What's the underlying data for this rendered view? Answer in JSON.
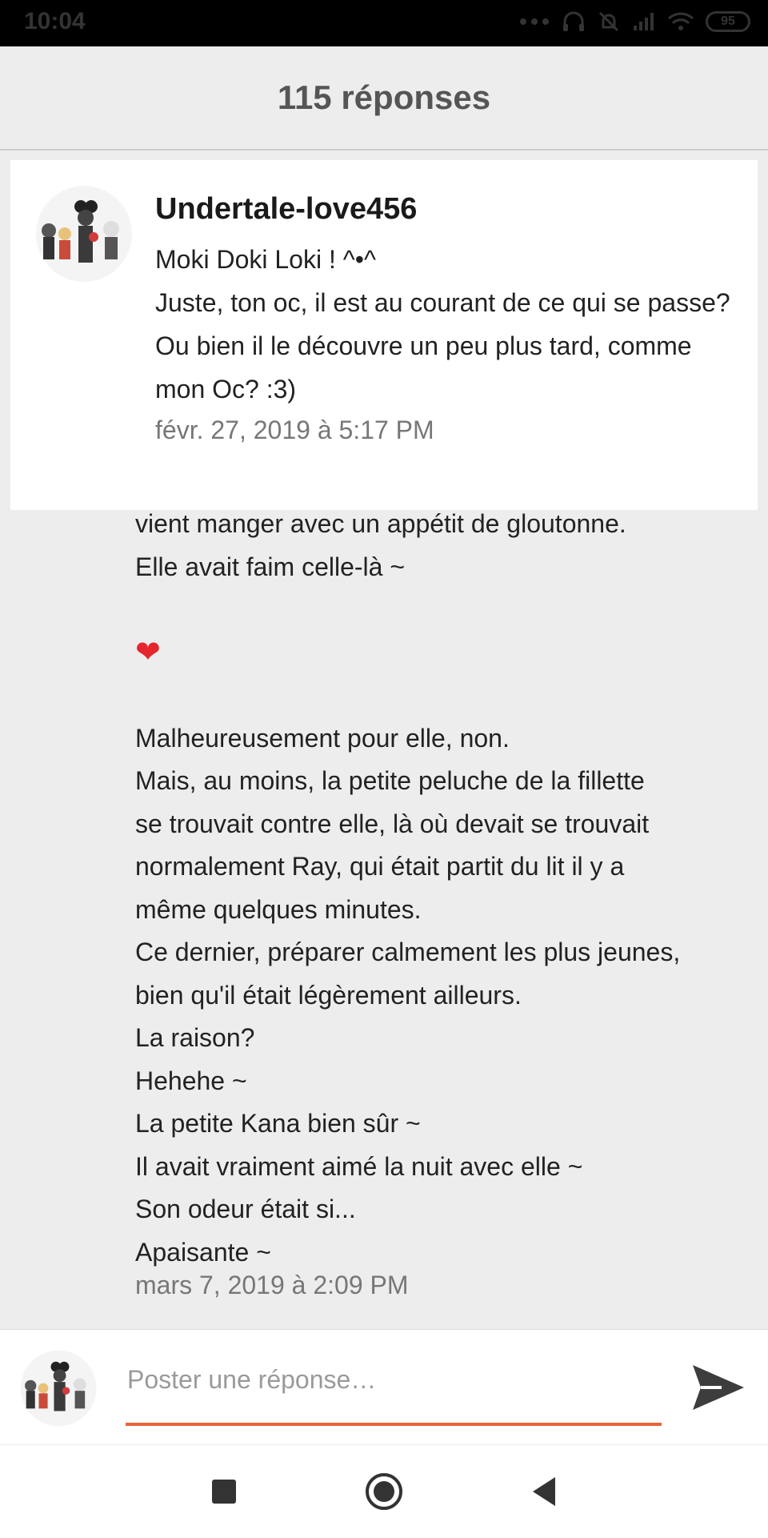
{
  "status_bar": {
    "time": "10:04",
    "battery": "95"
  },
  "header": {
    "title": "115 réponses"
  },
  "pinned_comment": {
    "username": "Undertale-love456",
    "lines": [
      "Moki Doki Loki ! ^•^",
      "Juste, ton oc, il est au courant de ce qui se passe?",
      "Ou bien il le découvre un peu plus tard, comme mon Oc? :3)"
    ],
    "timestamp": "févr. 27, 2019 à 5:17 PM"
  },
  "reply": {
    "lines": [
      "vient manger avec un appétit de gloutonne.",
      "Elle avait faim celle-là ~",
      "",
      "❤",
      "",
      "Malheureusement pour elle, non.",
      "Mais, au moins, la petite peluche de la fillette",
      "se trouvait contre elle, là où devait se trouvait",
      "normalement Ray, qui était partit du lit il y a",
      "même quelques minutes.",
      "Ce dernier, préparer calmement les plus jeunes,",
      "bien qu'il était légèrement ailleurs.",
      "La raison?",
      "Hehehe ~",
      "La petite Kana bien sûr ~",
      "Il avait vraiment aimé la nuit avec elle ~",
      "Son odeur était si...",
      "Apaisante ~"
    ],
    "timestamp": "mars 7, 2019 à 2:09 PM"
  },
  "composer": {
    "placeholder": "Poster une réponse…",
    "accent": "#e8643a"
  },
  "icons": {
    "send": "send-icon",
    "nav": [
      "recents-icon",
      "home-icon",
      "back-icon"
    ]
  }
}
